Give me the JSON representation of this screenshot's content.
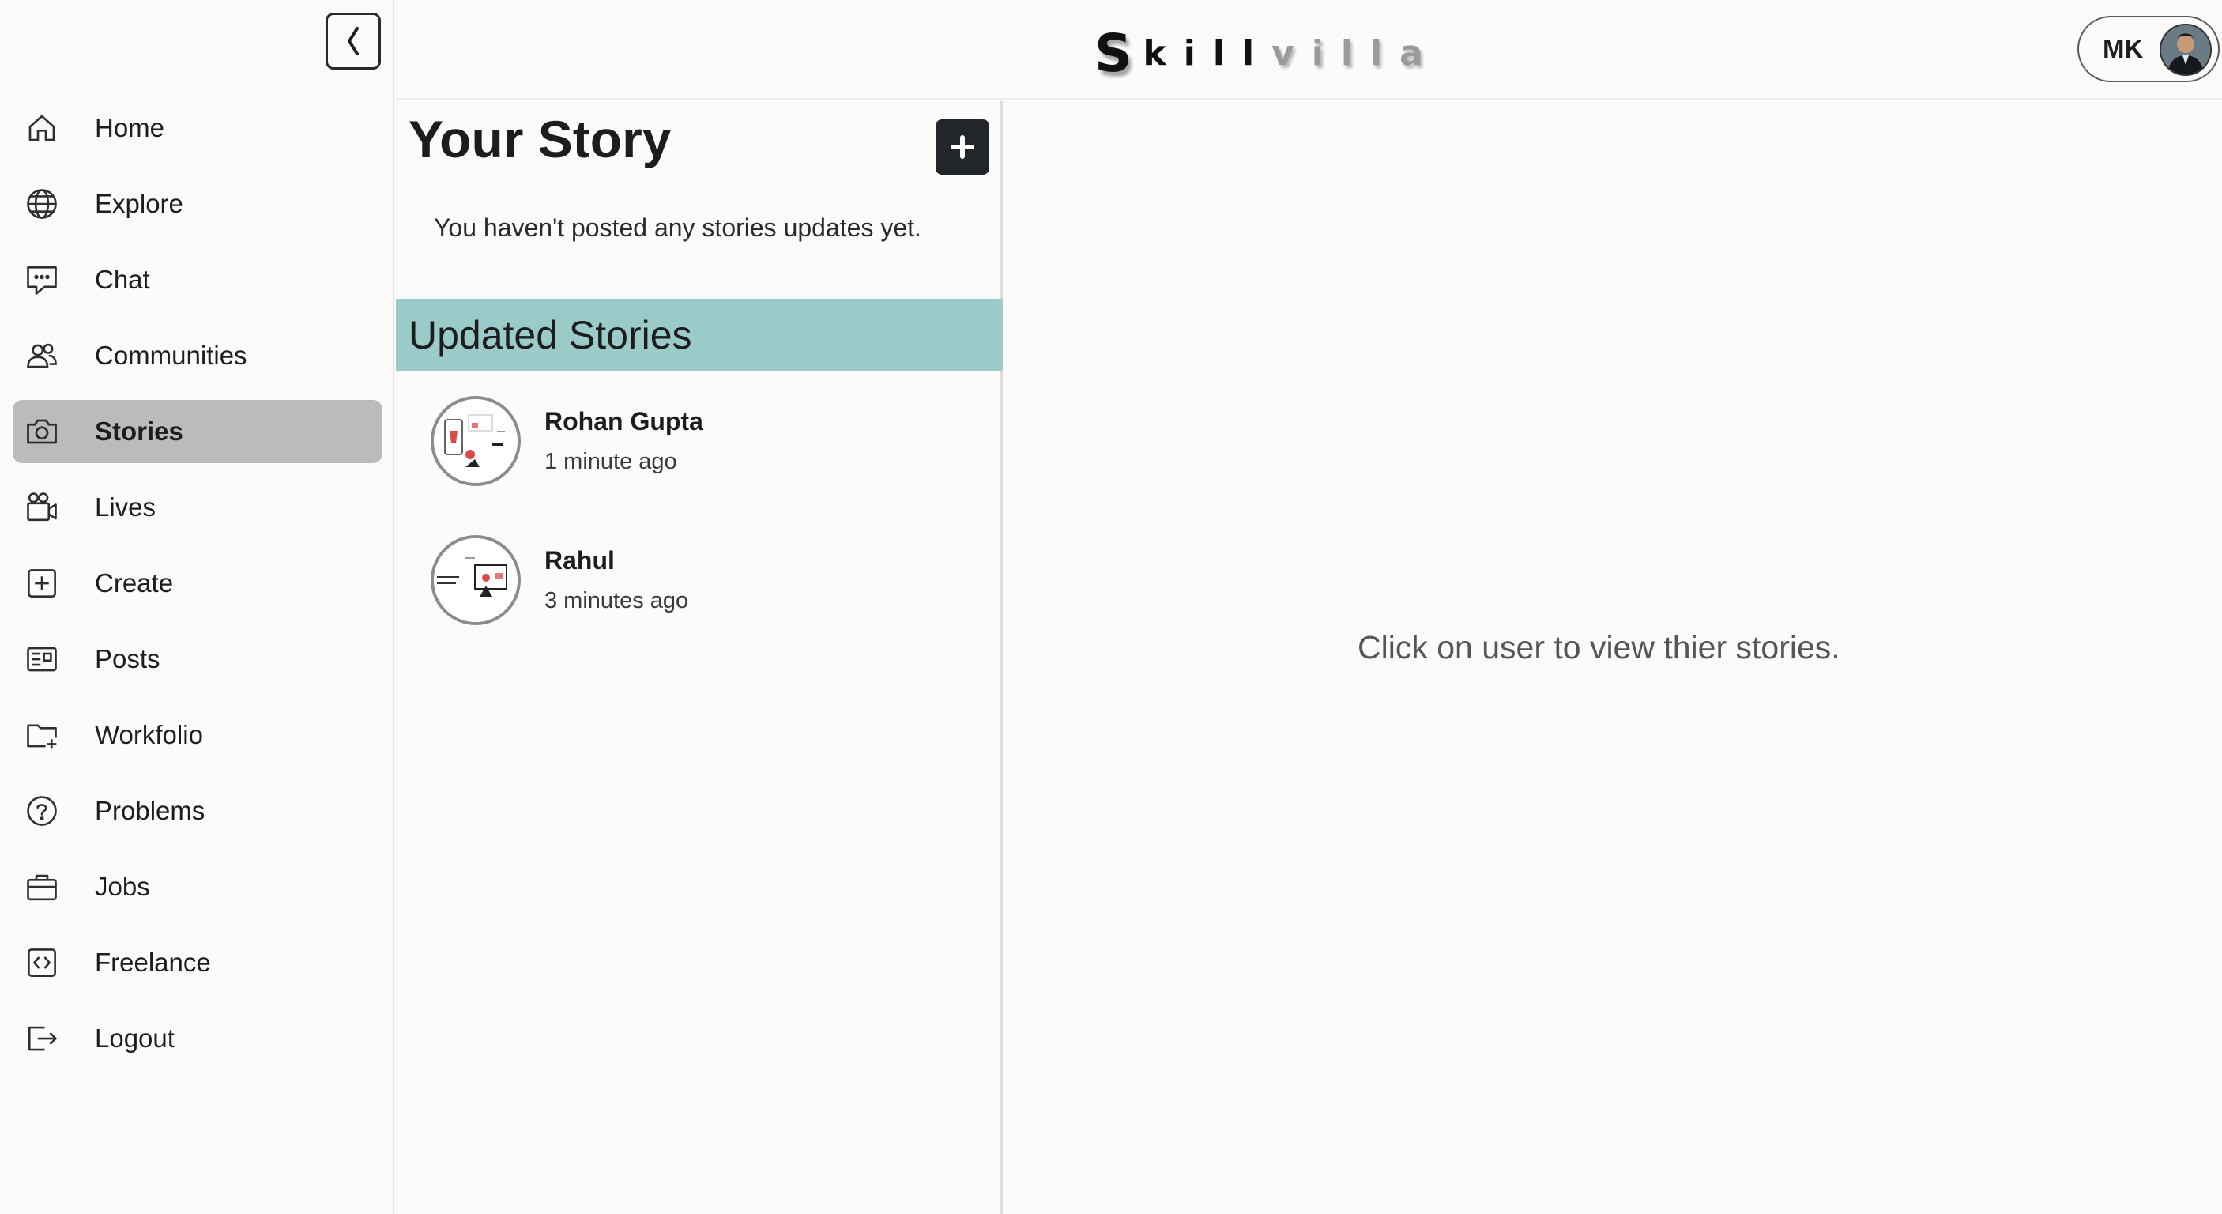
{
  "header": {
    "logo_first": "S",
    "logo_dark": "kill",
    "logo_light": "villa",
    "profile_initials": "MK"
  },
  "sidebar": {
    "items": [
      {
        "label": "Home",
        "icon": "home-icon"
      },
      {
        "label": "Explore",
        "icon": "globe-icon"
      },
      {
        "label": "Chat",
        "icon": "chat-icon"
      },
      {
        "label": "Communities",
        "icon": "users-icon"
      },
      {
        "label": "Stories",
        "icon": "camera-icon",
        "active": true
      },
      {
        "label": "Lives",
        "icon": "video-icon"
      },
      {
        "label": "Create",
        "icon": "plus-square-icon"
      },
      {
        "label": "Posts",
        "icon": "newspaper-icon"
      },
      {
        "label": "Workfolio",
        "icon": "folder-plus-icon"
      },
      {
        "label": "Problems",
        "icon": "question-circle-icon"
      },
      {
        "label": "Jobs",
        "icon": "briefcase-icon"
      },
      {
        "label": "Freelance",
        "icon": "code-square-icon"
      },
      {
        "label": "Logout",
        "icon": "logout-icon"
      }
    ]
  },
  "stories": {
    "title": "Your Story",
    "empty_message": "You haven't posted any stories updates yet.",
    "updated_title": "Updated Stories",
    "users": [
      {
        "name": "Rohan Gupta",
        "time": "1 minute ago"
      },
      {
        "name": "Rahul",
        "time": "3 minutes ago"
      }
    ]
  },
  "viewer": {
    "message": "Click on user to view thier stories."
  },
  "colors": {
    "background": "#fcfbfa",
    "active_nav": "#bcbbb9",
    "updated_bar": "#9bcbc9",
    "add_button": "#22262a"
  }
}
